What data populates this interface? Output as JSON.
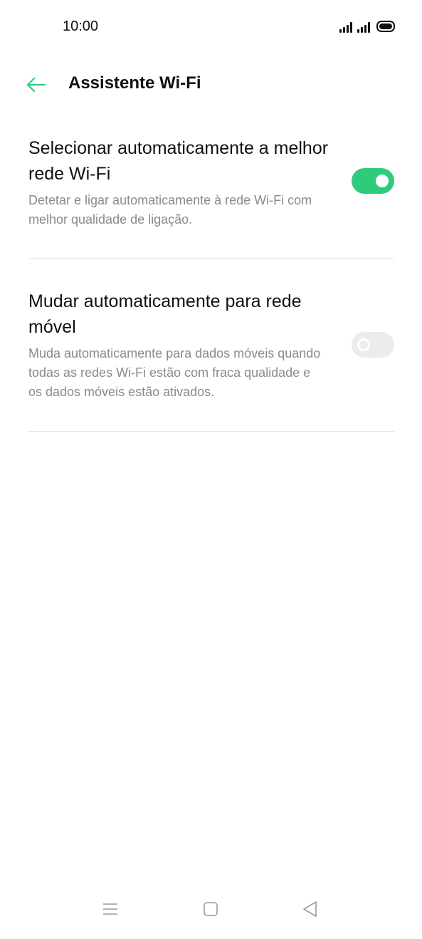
{
  "status_bar": {
    "time": "10:00",
    "icons": [
      "signal-icon",
      "signal-icon",
      "battery-icon"
    ]
  },
  "header": {
    "back_icon": "arrow-left-icon",
    "title": "Assistente Wi-Fi"
  },
  "settings": [
    {
      "title": "Selecionar automaticamente a melhor rede Wi-Fi",
      "description": "Detetar e ligar automaticamente à rede Wi-Fi com melhor qualidade de ligação.",
      "enabled": true
    },
    {
      "title": "Mudar automaticamente para rede móvel",
      "description": "Muda automaticamente para dados móveis quando todas as redes Wi-Fi estão com fraca qualidade e os dados móveis estão ativados.",
      "enabled": false
    }
  ],
  "nav_bar": {
    "items": [
      "menu-icon",
      "home-icon",
      "back-triangle-icon"
    ]
  },
  "colors": {
    "accent": "#2ecb7a",
    "toggle_off": "#ececec",
    "secondary_text": "#8a8a8a"
  }
}
